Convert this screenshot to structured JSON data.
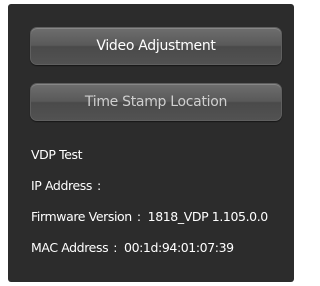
{
  "buttons": {
    "video_adjustment": "Video Adjustment",
    "time_stamp_location": "Time Stamp Location"
  },
  "info": {
    "device_name": "VDP Test",
    "ip_address_label": "IP Address",
    "ip_address_value": "",
    "firmware_label": "Firmware Version",
    "firmware_value": "1818_VDP 1.105.0.0",
    "mac_label": "MAC Address",
    "mac_value": "00:1d:94:01:07:39",
    "separator": ":"
  },
  "colors": {
    "panel_background": "#2c2c2c",
    "button_face": "#595959",
    "text_primary": "#ffffff",
    "text_secondary": "#cfcfcf"
  }
}
